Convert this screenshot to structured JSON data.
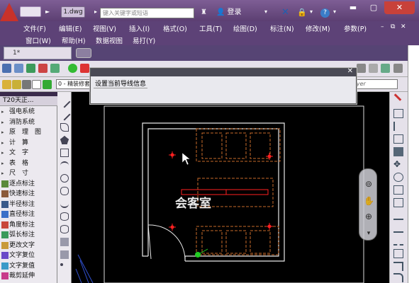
{
  "titlebar": {
    "doc_tab": "1.dwg",
    "search_placeholder": "键入关键字或短语",
    "login_label": "登录"
  },
  "menu": {
    "row1": [
      "文件(F)",
      "编辑(E)",
      "视图(V)",
      "插入(I)",
      "格式(O)",
      "工具(T)",
      "绘图(D)",
      "标注(N)",
      "修改(M)",
      "参数(P)"
    ],
    "row2": [
      "窗口(W)",
      "帮助(H)",
      "数据视图",
      "易打(Y)"
    ]
  },
  "tabs": {
    "drawing_tab": "1*"
  },
  "toolbar": {
    "layer_combo": "0 - 精装修套",
    "layer_combo_right": "ayer"
  },
  "dialog": {
    "title": "设置当前导线信息"
  },
  "t20": {
    "title": "T20天正...",
    "items": [
      {
        "label": "强电系统",
        "kind": "arrow"
      },
      {
        "label": "消防系统",
        "kind": "arrow"
      },
      {
        "label": "原理图",
        "kind": "arrow"
      },
      {
        "label": "计算",
        "kind": "arrow"
      },
      {
        "label": "文字",
        "kind": "arrow"
      },
      {
        "label": "表格",
        "kind": "arrow"
      },
      {
        "label": "尺寸",
        "kind": "arrow"
      },
      {
        "label": "逐点标注",
        "kind": "icon"
      },
      {
        "label": "快速标注",
        "kind": "icon"
      },
      {
        "label": "半径标注",
        "kind": "icon"
      },
      {
        "label": "直径标注",
        "kind": "icon"
      },
      {
        "label": "角度标注",
        "kind": "icon"
      },
      {
        "label": "弧长标注",
        "kind": "icon"
      },
      {
        "label": "更改文字",
        "kind": "icon"
      },
      {
        "label": "文字复位",
        "kind": "icon"
      },
      {
        "label": "文字复值",
        "kind": "icon"
      },
      {
        "label": "裁剪延伸",
        "kind": "icon"
      }
    ]
  },
  "drawing": {
    "room_label": "会客室"
  },
  "colors": {
    "accent_purple": "#5d4277",
    "furniture_orange": "#c66a2a",
    "symbol_red": "#ff2020",
    "wall_white": "#e8e8e8",
    "cursor_green": "#22cc22"
  }
}
